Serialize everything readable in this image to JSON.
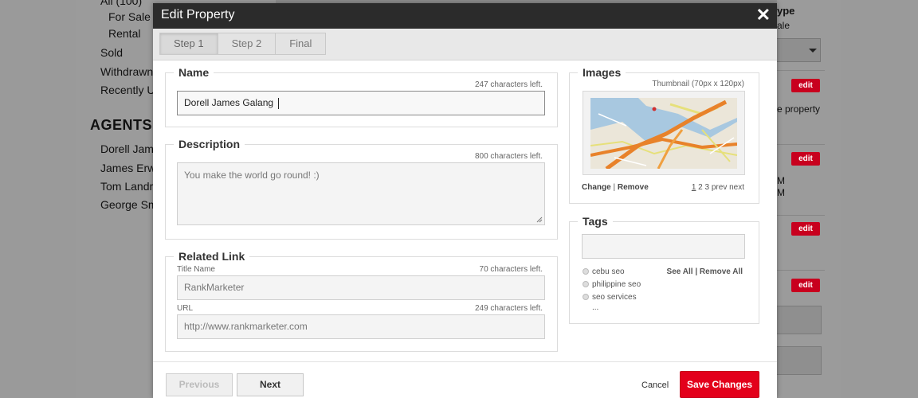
{
  "background": {
    "filters": [
      "All (100)",
      "For Sale",
      "Rental",
      "Sold",
      "Withdrawn",
      "Recently U"
    ],
    "agents_heading": "AGENTS",
    "agents": [
      "Dorell Jam",
      "James Erw",
      "Tom Landr",
      "George Sm"
    ],
    "right_type_heading": "ype",
    "right_sale": "ale",
    "right_property": "e property",
    "right_m": [
      "M",
      "M"
    ],
    "edit_label": "edit"
  },
  "modal": {
    "title": "Edit Property",
    "close": "✕",
    "steps": [
      {
        "label": "Step 1",
        "active": true
      },
      {
        "label": "Step 2",
        "active": false
      },
      {
        "label": "Final",
        "active": false
      }
    ]
  },
  "name_section": {
    "legend": "Name",
    "count": "247 characters left.",
    "value": "Dorell James Galang"
  },
  "description_section": {
    "legend": "Description",
    "count": "800 characters left.",
    "placeholder": "You make the world go round! :)"
  },
  "related_link_section": {
    "legend": "Related Link",
    "title_label": "Title Name",
    "title_count": "70 characters left.",
    "title_placeholder": "RankMarketer",
    "url_label": "URL",
    "url_count": "249 characters left.",
    "url_placeholder": "http://www.rankmarketer.com"
  },
  "images_section": {
    "legend": "Images",
    "thumb_hint": "Thumbnail (70px x 120px)",
    "change": "Change",
    "separator": "|",
    "remove": "Remove",
    "pages": [
      "1",
      "2",
      "3"
    ],
    "prev": "prev",
    "next": "next"
  },
  "tags_section": {
    "legend": "Tags",
    "tags": [
      "cebu seo",
      "philippine seo",
      "seo services"
    ],
    "more": "...",
    "see_all": "See All",
    "remove_all": "Remove All"
  },
  "footer": {
    "previous": "Previous",
    "next": "Next",
    "cancel": "Cancel",
    "save": "Save Changes"
  },
  "colors": {
    "accent": "#e3001b",
    "titlebar": "#2b2b2b"
  }
}
